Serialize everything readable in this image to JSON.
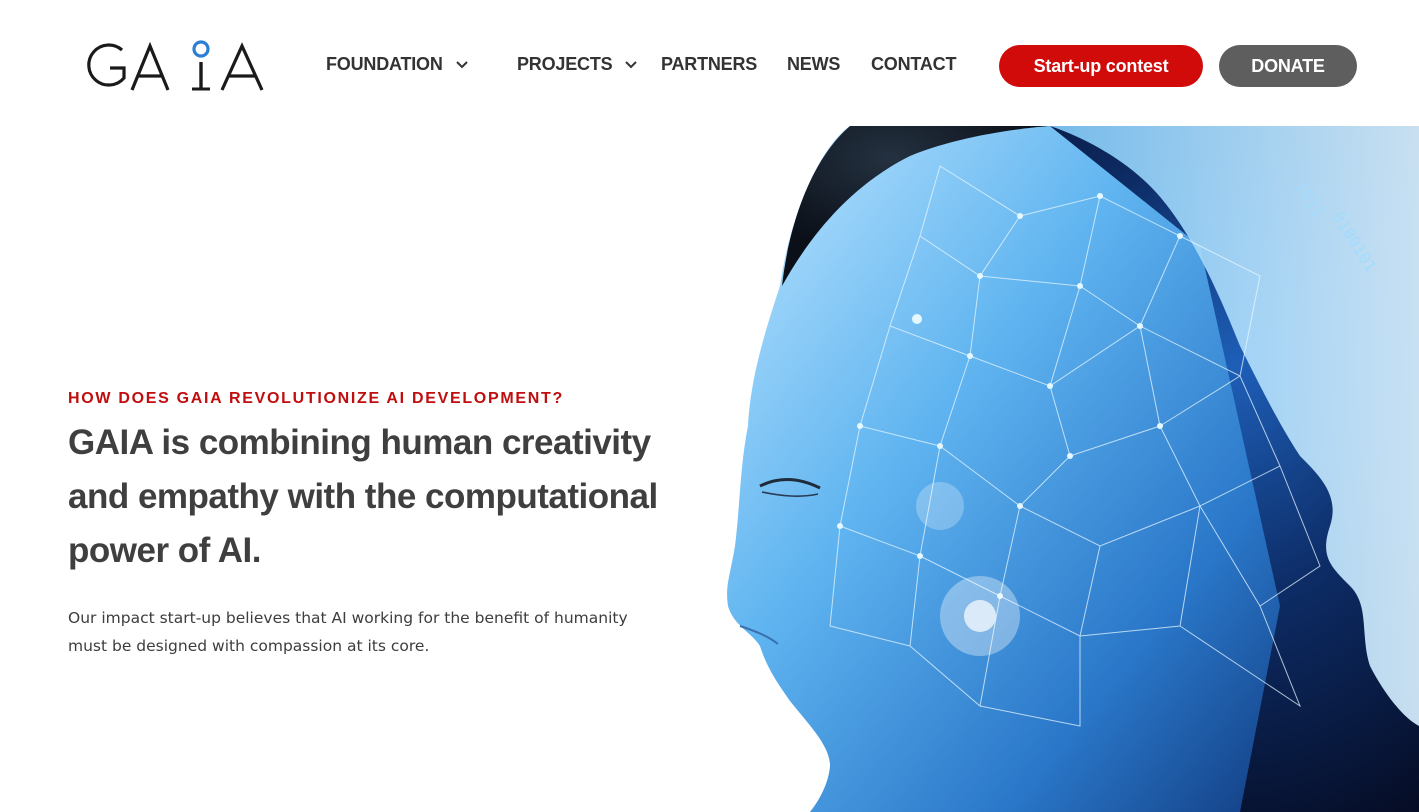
{
  "logo": {
    "text": "GAIA"
  },
  "nav": {
    "items": [
      {
        "label": "FOUNDATION",
        "has_dropdown": true
      },
      {
        "label": "PROJECTS",
        "has_dropdown": true
      },
      {
        "label": "PARTNERS",
        "has_dropdown": false
      },
      {
        "label": "NEWS",
        "has_dropdown": false
      },
      {
        "label": "CONTACT",
        "has_dropdown": false
      }
    ],
    "contest_label": "Start-up contest",
    "donate_label": "DONATE"
  },
  "hero": {
    "eyebrow": "HOW DOES GAIA REVOLUTIONIZE AI DEVELOPMENT?",
    "headline": "GAIA is combining human creativity and empathy with the computational power of AI.",
    "subtext": "Our impact start-up believes that AI working for the benefit of humanity must be designed with compassion at its core."
  },
  "colors": {
    "accent_red": "#d10a0a",
    "donate_gray": "#5e5e5e",
    "logo_dot_blue": "#2a7fd4"
  }
}
